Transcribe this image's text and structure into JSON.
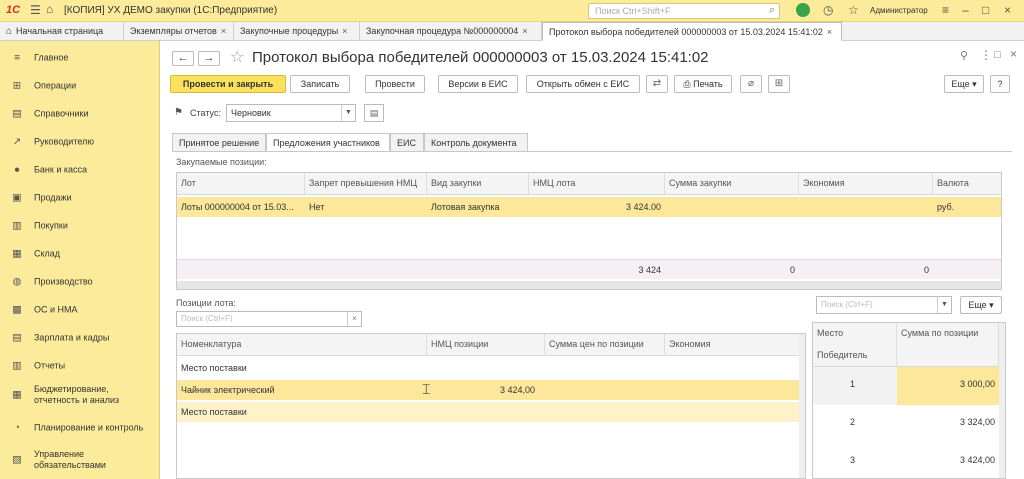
{
  "titlebar": {
    "logo": "1С",
    "title": "[КОПИЯ] УХ ДЕМО закупки  (1С:Предприятие)",
    "search_placeholder": "Поиск Ctrl+Shift+F",
    "user": "Администратор"
  },
  "tabs": [
    {
      "label": "Начальная страница",
      "close": ""
    },
    {
      "label": "Экземпляры отчетов",
      "close": "×"
    },
    {
      "label": "Закупочные процедуры",
      "close": "×"
    },
    {
      "label": "Закупочная процедура №000000004",
      "close": "×"
    },
    {
      "label": "Протокол выбора победителей 000000003 от 15.03.2024 15:41:02",
      "close": "×"
    }
  ],
  "sidebar": [
    {
      "icon": "≡",
      "label": "Главное"
    },
    {
      "icon": "⊞",
      "label": "Операции"
    },
    {
      "icon": "▤",
      "label": "Справочники"
    },
    {
      "icon": "↗",
      "label": "Руководителю"
    },
    {
      "icon": "●",
      "label": "Банк и касса"
    },
    {
      "icon": "▣",
      "label": "Продажи"
    },
    {
      "icon": "▥",
      "label": "Покупки"
    },
    {
      "icon": "▦",
      "label": "Склад"
    },
    {
      "icon": "◍",
      "label": "Производство"
    },
    {
      "icon": "▩",
      "label": "ОС и НМА"
    },
    {
      "icon": "▤",
      "label": "Зарплата и кадры"
    },
    {
      "icon": "▥",
      "label": "Отчеты"
    },
    {
      "icon": "▦",
      "label": "Бюджетирование, отчетность и анализ"
    },
    {
      "icon": "◔",
      "label": "Планирование и контроль"
    },
    {
      "icon": "▧",
      "label": "Управление обязательствами"
    }
  ],
  "document": {
    "title": "Протокол выбора победителей 000000003 от 15.03.2024 15:41:02",
    "buttons": {
      "post_close": "Провести и закрыть",
      "save": "Записать",
      "post": "Провести",
      "versions": "Версии в ЕИС",
      "open_exchange": "Открыть обмен с ЕИС",
      "print": "Печать",
      "more": "Еще",
      "help": "?"
    },
    "status_label": "Статус:",
    "status_value": "Черновик",
    "form_tabs": [
      "Принятое решение",
      "Предложения участников",
      "ЕИС",
      "Контроль документа"
    ]
  },
  "purchased": {
    "label": "Закупаемые позиции:",
    "columns": [
      "Лот",
      "Запрет превышения НМЦ",
      "Вид закупки",
      "НМЦ лота",
      "Сумма закупки",
      "Экономия",
      "Валюта"
    ],
    "rows": [
      [
        "Лоты 000000004 от 15.03...",
        "Нет",
        "Лотовая закупка",
        "3 424.00",
        "",
        "",
        "руб."
      ]
    ],
    "footer": [
      "3 424",
      "0",
      "0"
    ]
  },
  "positions": {
    "label": "Позиции лота:",
    "search_placeholder": "Поиск (Ctrl+F)",
    "columns": [
      "Номенклатура",
      "НМЦ позиции",
      "Сумма цен по позиции",
      "Экономия"
    ],
    "rows": [
      [
        "Место поставки",
        "",
        "",
        ""
      ],
      [
        "Чайник электрический",
        "3 424,00",
        "",
        ""
      ],
      [
        "Место поставки",
        "",
        "",
        ""
      ]
    ]
  },
  "ranking": {
    "search_placeholder": "Поиск (Ctrl+F)",
    "more": "Еще",
    "columns": [
      "Место",
      "Сумма по позиции"
    ],
    "subheader": "Победитель",
    "rows": [
      [
        "1",
        "3 000,00"
      ],
      [
        "2",
        "3 324,00"
      ],
      [
        "3",
        "3 424,00"
      ]
    ]
  }
}
